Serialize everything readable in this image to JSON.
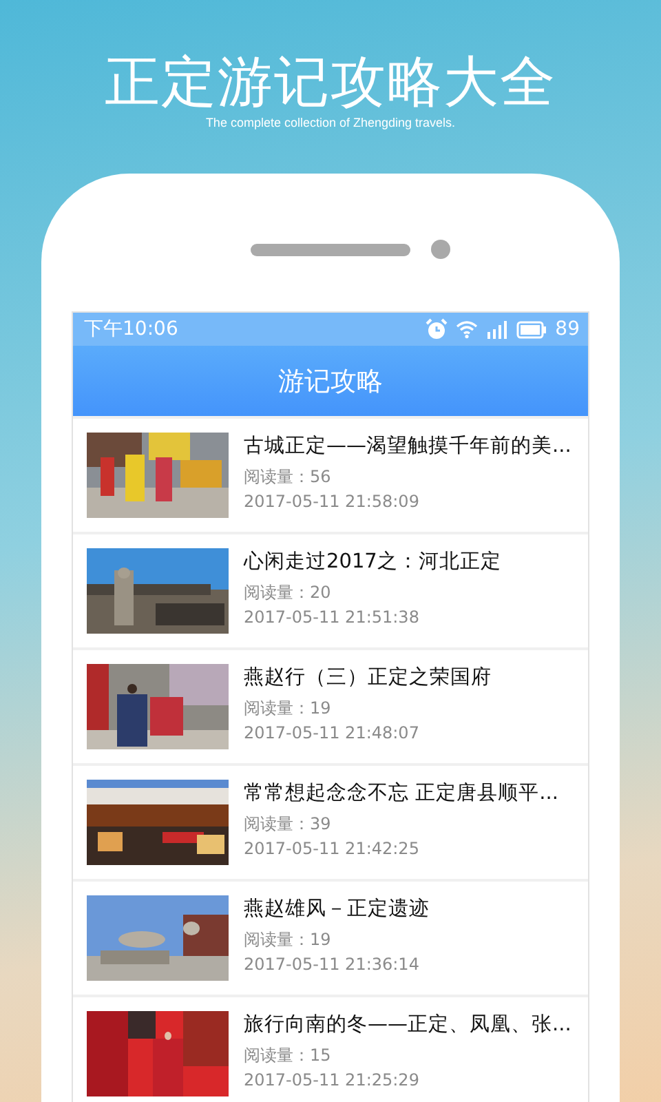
{
  "promo": {
    "title": "正定游记攻略大全",
    "subtitle": "The complete collection of Zhengding travels."
  },
  "status_bar": {
    "time": "下午10:06",
    "battery": "89"
  },
  "header": {
    "title": "游记攻略"
  },
  "articles": [
    {
      "title": "古城正定——渴望触摸千年前的美...",
      "reads": "阅读量：56",
      "date": "2017-05-11 21:58:09"
    },
    {
      "title": "心闲走过2017之：河北正定",
      "reads": "阅读量：20",
      "date": "2017-05-11 21:51:38"
    },
    {
      "title": "燕赵行（三）正定之荣国府",
      "reads": "阅读量：19",
      "date": "2017-05-11 21:48:07"
    },
    {
      "title": "常常想起念念不忘 正定唐县顺平...",
      "reads": "阅读量：39",
      "date": "2017-05-11 21:42:25"
    },
    {
      "title": "燕赵雄风－正定遗迹",
      "reads": "阅读量：19",
      "date": "2017-05-11 21:36:14"
    },
    {
      "title": "旅行向南的冬——正定、凤凰、张...",
      "reads": "阅读量：15",
      "date": "2017-05-11 21:25:29"
    }
  ]
}
